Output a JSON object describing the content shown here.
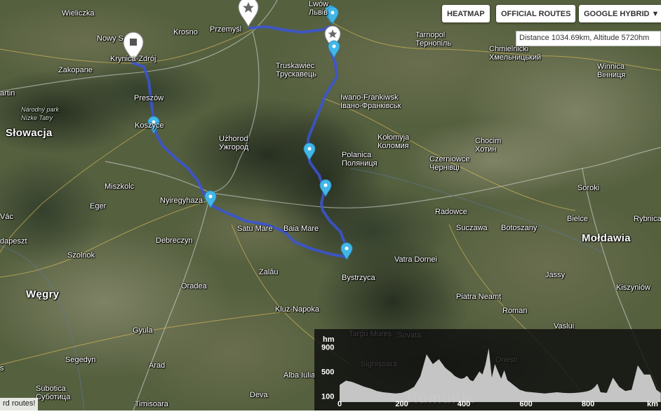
{
  "map": {
    "place_labels": [
      {
        "name": "label-wieliczka",
        "lines": [
          "Wieliczka"
        ],
        "kind": "town"
      },
      {
        "name": "label-nowy-sacz",
        "lines": [
          "Nowy S"
        ],
        "kind": "town"
      },
      {
        "name": "label-krynica",
        "lines": [
          "Krynica-Zdrój"
        ],
        "kind": "town"
      },
      {
        "name": "label-krosno",
        "lines": [
          "Krosno"
        ],
        "kind": "town"
      },
      {
        "name": "label-przemysl",
        "lines": [
          "Przemyśl"
        ],
        "kind": "town"
      },
      {
        "name": "label-lwow",
        "lines": [
          "Lwów",
          "Львів"
        ],
        "kind": "town"
      },
      {
        "name": "label-tarnopol",
        "lines": [
          "Tarnopol",
          "Тернопіль"
        ],
        "kind": "town"
      },
      {
        "name": "label-chmielnicki",
        "lines": [
          "Chmielnicki",
          "Хмельницький"
        ],
        "kind": "town"
      },
      {
        "name": "label-winnica",
        "lines": [
          "Winnica",
          "Вінниця"
        ],
        "kind": "town"
      },
      {
        "name": "label-zakopane",
        "lines": [
          "Zakopane"
        ],
        "kind": "town"
      },
      {
        "name": "label-martin",
        "lines": [
          "artin"
        ],
        "kind": "town"
      },
      {
        "name": "label-tatra-park",
        "lines": [
          "Národný park",
          "Nízke Tatry"
        ],
        "kind": "park"
      },
      {
        "name": "label-presov",
        "lines": [
          "Preszów"
        ],
        "kind": "town"
      },
      {
        "name": "label-kosice",
        "lines": [
          "Koszyce"
        ],
        "kind": "town"
      },
      {
        "name": "label-slowacja",
        "lines": [
          "Słowacja"
        ],
        "kind": "country"
      },
      {
        "name": "label-truskawiec",
        "lines": [
          "Truskawiec",
          "Трускавець"
        ],
        "kind": "town"
      },
      {
        "name": "label-iwano",
        "lines": [
          "Iwano-Frankiwsk",
          "Івано-Франківськ"
        ],
        "kind": "town"
      },
      {
        "name": "label-uzhorod",
        "lines": [
          "Użhorod",
          "Ужгород"
        ],
        "kind": "town"
      },
      {
        "name": "label-kolomyja",
        "lines": [
          "Kołomyja",
          "Коломия"
        ],
        "kind": "town"
      },
      {
        "name": "label-chocim",
        "lines": [
          "Chocim",
          "Хотин"
        ],
        "kind": "town"
      },
      {
        "name": "label-polanica",
        "lines": [
          "Polanica",
          "Поляниця"
        ],
        "kind": "town"
      },
      {
        "name": "label-czerniowce",
        "lines": [
          "Czerniowce",
          "Чернівці"
        ],
        "kind": "town"
      },
      {
        "name": "label-miszkolc",
        "lines": [
          "Miszkolc"
        ],
        "kind": "town"
      },
      {
        "name": "label-soroki",
        "lines": [
          "Soroki"
        ],
        "kind": "town"
      },
      {
        "name": "label-eger",
        "lines": [
          "Eger"
        ],
        "kind": "town"
      },
      {
        "name": "label-nyiregyhaza",
        "lines": [
          "Nyiregyhaza"
        ],
        "kind": "town"
      },
      {
        "name": "label-radowce",
        "lines": [
          "Radowce"
        ],
        "kind": "town"
      },
      {
        "name": "label-vac",
        "lines": [
          "Vác"
        ],
        "kind": "town"
      },
      {
        "name": "label-satu-mare",
        "lines": [
          "Satu Mare"
        ],
        "kind": "town"
      },
      {
        "name": "label-baia-mare",
        "lines": [
          "Baia Mare"
        ],
        "kind": "town"
      },
      {
        "name": "label-suczawa",
        "lines": [
          "Suczawa"
        ],
        "kind": "town"
      },
      {
        "name": "label-botoszany",
        "lines": [
          "Botoszany"
        ],
        "kind": "town"
      },
      {
        "name": "label-bielce",
        "lines": [
          "Bielce"
        ],
        "kind": "town"
      },
      {
        "name": "label-rybnica",
        "lines": [
          "Rybnica"
        ],
        "kind": "town"
      },
      {
        "name": "label-budapeszt",
        "lines": [
          "dapeszt"
        ],
        "kind": "town"
      },
      {
        "name": "label-debreczyn",
        "lines": [
          "Debreczyn"
        ],
        "kind": "town"
      },
      {
        "name": "label-moldawia",
        "lines": [
          "Mołdawia"
        ],
        "kind": "country"
      },
      {
        "name": "label-vatra-dornei",
        "lines": [
          "Vatra Dornei"
        ],
        "kind": "town"
      },
      {
        "name": "label-szolnok",
        "lines": [
          "Szolnok"
        ],
        "kind": "town"
      },
      {
        "name": "label-bystrzyca",
        "lines": [
          "Bystrzyca"
        ],
        "kind": "town"
      },
      {
        "name": "label-zalau",
        "lines": [
          "Zalău"
        ],
        "kind": "town"
      },
      {
        "name": "label-jassy",
        "lines": [
          "Jassy"
        ],
        "kind": "town"
      },
      {
        "name": "label-oradea",
        "lines": [
          "Oradea"
        ],
        "kind": "town"
      },
      {
        "name": "label-kiszyniow",
        "lines": [
          "Kiszyniów"
        ],
        "kind": "town"
      },
      {
        "name": "label-wegry",
        "lines": [
          "Węgry"
        ],
        "kind": "country"
      },
      {
        "name": "label-piatra-neamt",
        "lines": [
          "Piatra Neamț"
        ],
        "kind": "town"
      },
      {
        "name": "label-kluz-napoka",
        "lines": [
          "Kluż-Napoka"
        ],
        "kind": "town"
      },
      {
        "name": "label-roman",
        "lines": [
          "Roman"
        ],
        "kind": "town"
      },
      {
        "name": "label-vaslui",
        "lines": [
          "Vaslui"
        ],
        "kind": "town"
      },
      {
        "name": "label-gyula",
        "lines": [
          "Gyula"
        ],
        "kind": "town"
      },
      {
        "name": "label-targu-mures",
        "lines": [
          "Targu Mureș"
        ],
        "kind": "town"
      },
      {
        "name": "label-sovata",
        "lines": [
          "Sovata"
        ],
        "kind": "town"
      },
      {
        "name": "label-sighisoara",
        "lines": [
          "Sighișoara"
        ],
        "kind": "town"
      },
      {
        "name": "label-onesti",
        "lines": [
          "Onești"
        ],
        "kind": "town"
      },
      {
        "name": "label-segedyn",
        "lines": [
          "Segedyn"
        ],
        "kind": "town"
      },
      {
        "name": "label-arad",
        "lines": [
          "Arad"
        ],
        "kind": "town"
      },
      {
        "name": "label-bekes",
        "lines": [
          "s"
        ],
        "kind": "town"
      },
      {
        "name": "label-subotica",
        "lines": [
          "Subotica",
          "Суботица"
        ],
        "kind": "town"
      },
      {
        "name": "label-alba-iulia",
        "lines": [
          "Alba Iulia"
        ],
        "kind": "town"
      },
      {
        "name": "label-deva",
        "lines": [
          "Deva"
        ],
        "kind": "town"
      },
      {
        "name": "label-timisoara",
        "lines": [
          "Timisoara"
        ],
        "kind": "town"
      },
      {
        "name": "label-rumunia",
        "lines": [
          "Rumunia"
        ],
        "kind": "country"
      }
    ]
  },
  "controls": {
    "heatmap": "HEATMAP",
    "official_routes": "OFFICIAL ROUTES",
    "map_type": "GOOGLE HYBRID ▼"
  },
  "info": {
    "text": "Distance 1034.69km, Altitude 5720hm"
  },
  "status": {
    "text": "rd routes!"
  },
  "chart_data": {
    "type": "area",
    "title": "",
    "ylabel": "hm",
    "xlabel": "km",
    "y_ticks": [
      100,
      500,
      900
    ],
    "x_ticks": [
      0,
      200,
      400,
      600,
      800
    ],
    "xlim": [
      0,
      1034.69
    ],
    "ylim": [
      0,
      1100
    ],
    "series": [
      {
        "x": [
          0,
          20,
          40,
          60,
          80,
          100,
          120,
          140,
          160,
          180,
          200,
          220,
          240,
          260,
          280,
          300,
          320,
          340,
          350,
          360,
          370,
          380,
          390,
          400,
          410,
          420,
          430,
          440,
          450,
          460,
          470,
          480,
          490,
          500,
          510,
          520,
          530,
          540,
          550,
          560,
          570,
          580,
          600,
          620,
          640,
          660,
          680,
          700,
          720,
          740,
          760,
          780,
          790,
          800,
          810,
          820,
          830,
          840,
          860,
          880,
          900,
          920,
          940,
          960,
          980,
          1000,
          1020,
          1034
        ],
        "y": [
          280,
          350,
          330,
          290,
          250,
          220,
          180,
          160,
          150,
          140,
          150,
          190,
          250,
          420,
          780,
          620,
          700,
          560,
          520,
          480,
          430,
          400,
          380,
          390,
          430,
          360,
          340,
          420,
          500,
          450,
          620,
          880,
          400,
          620,
          500,
          380,
          520,
          360,
          320,
          280,
          240,
          200,
          170,
          160,
          150,
          140,
          150,
          160,
          150,
          145,
          150,
          160,
          170,
          180,
          200,
          240,
          300,
          160,
          150,
          400,
          250,
          180,
          200,
          600,
          450,
          450,
          200,
          150
        ]
      }
    ]
  }
}
